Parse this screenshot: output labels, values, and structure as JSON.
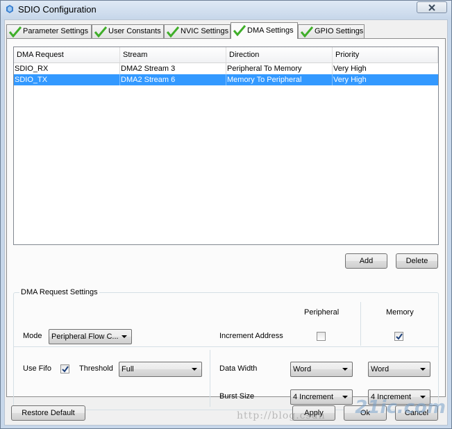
{
  "window": {
    "title": "SDIO Configuration"
  },
  "tabs": [
    {
      "label": "Parameter Settings",
      "active": false
    },
    {
      "label": "User Constants",
      "active": false
    },
    {
      "label": "NVIC Settings",
      "active": false
    },
    {
      "label": "DMA Settings",
      "active": true
    },
    {
      "label": "GPIO Settings",
      "active": false
    }
  ],
  "dma_table": {
    "headers": [
      "DMA Request",
      "Stream",
      "Direction",
      "Priority"
    ],
    "rows": [
      {
        "cells": [
          "SDIO_RX",
          "DMA2 Stream 3",
          "Peripheral To Memory",
          "Very High"
        ],
        "selected": false
      },
      {
        "cells": [
          "SDIO_TX",
          "DMA2 Stream 6",
          "Memory To Peripheral",
          "Very High"
        ],
        "selected": true
      }
    ]
  },
  "buttons": {
    "add": "Add",
    "delete": "Delete",
    "restore_default": "Restore Default",
    "apply": "Apply",
    "ok": "Ok",
    "cancel": "Cancel"
  },
  "settings": {
    "group_title": "DMA Request Settings",
    "peripheral_header": "Peripheral",
    "memory_header": "Memory",
    "mode_label": "Mode",
    "mode_value": "Peripheral Flow C...",
    "increment_address_label": "Increment Address",
    "peripheral_increment": false,
    "memory_increment": true,
    "use_fifo_label": "Use Fifo",
    "use_fifo": true,
    "threshold_label": "Threshold",
    "threshold_value": "Full",
    "data_width_label": "Data Width",
    "peripheral_data_width": "Word",
    "memory_data_width": "Word",
    "burst_size_label": "Burst Size",
    "peripheral_burst_size": "4 Increment",
    "memory_burst_size": "4 Increment"
  },
  "watermark": {
    "brand": "21ic.com",
    "url": "http://blog.csdn"
  },
  "colors": {
    "selection": "#3399ff",
    "window_frame": "#c7d7ea",
    "check_green": "#3fae29"
  }
}
